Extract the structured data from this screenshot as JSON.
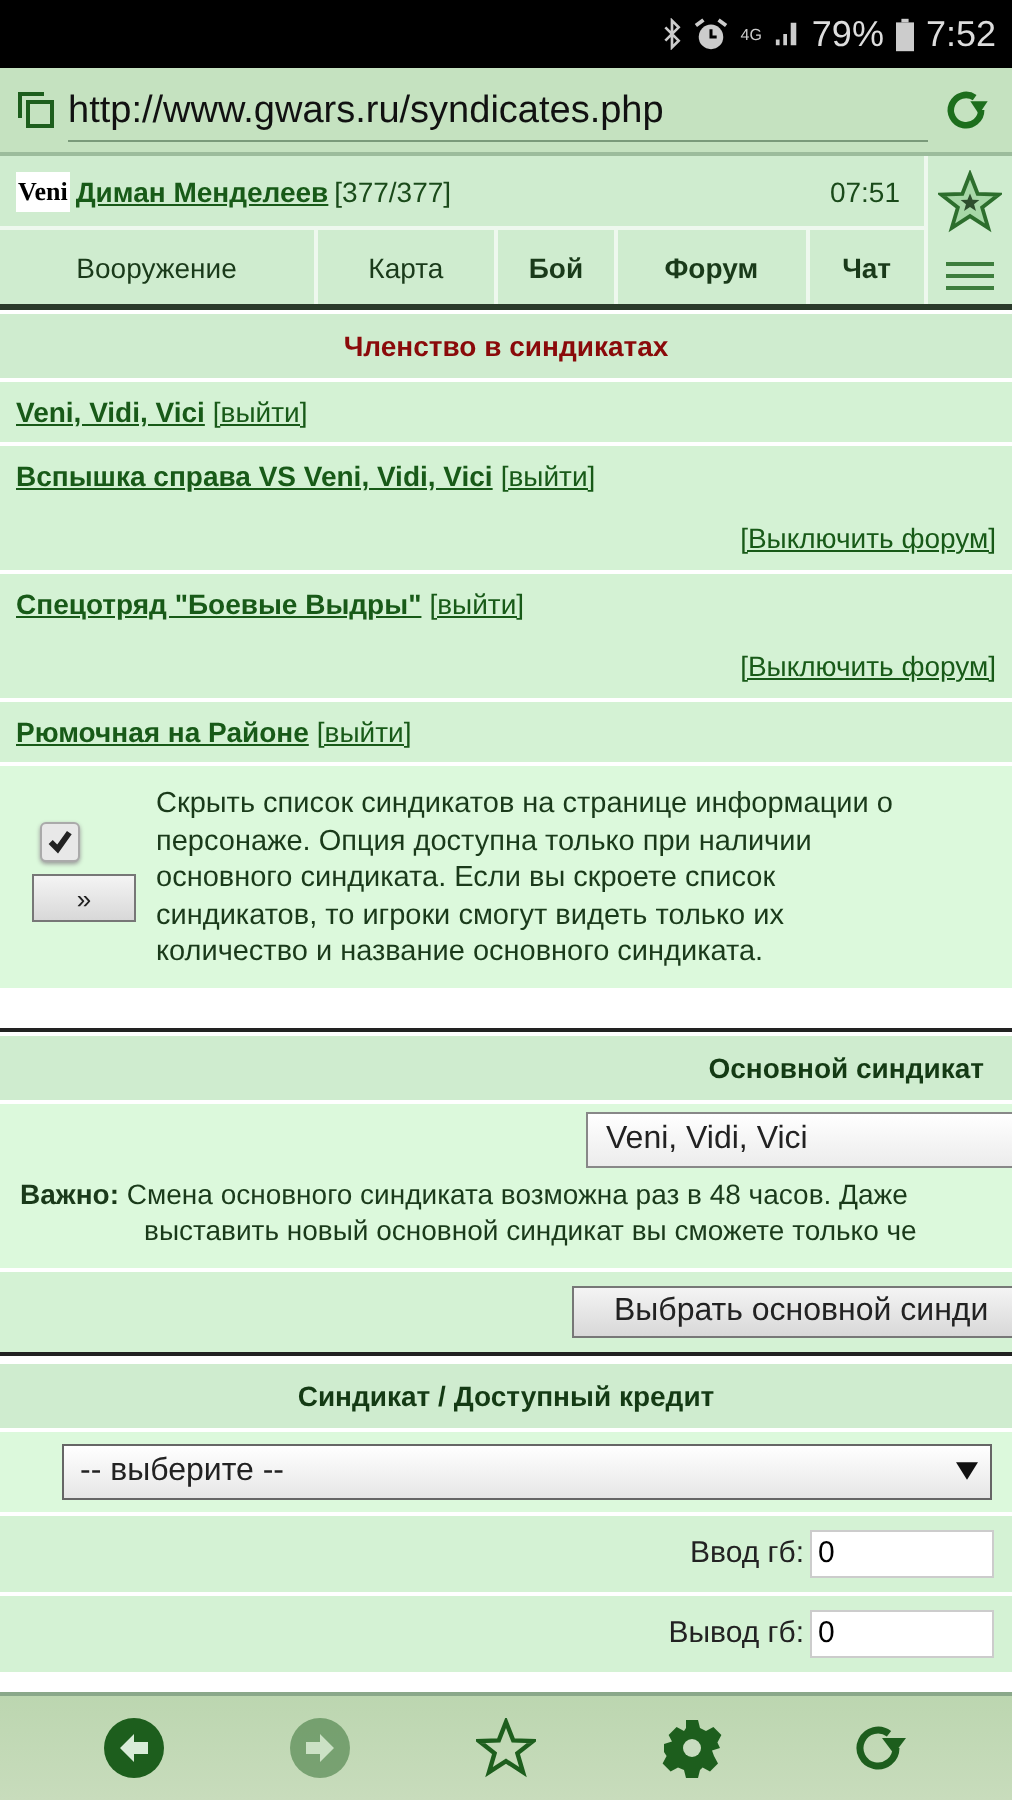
{
  "status_bar": {
    "network": "4G",
    "battery": "79%",
    "time": "7:52"
  },
  "address_bar": {
    "url": "http://www.gwars.ru/syndicates.php"
  },
  "header": {
    "badge": "Veni",
    "player": "Диман Менделеев",
    "hp": "[377/377]",
    "time": "07:51"
  },
  "nav": [
    {
      "label": "Вооружение",
      "bold": false
    },
    {
      "label": "Карта",
      "bold": false
    },
    {
      "label": "Бой",
      "bold": true
    },
    {
      "label": "Форум",
      "bold": true
    },
    {
      "label": "Чат",
      "bold": true
    }
  ],
  "membership": {
    "title": "Членство в синдикатах",
    "items": [
      {
        "name": "Veni, Vidi, Vici",
        "leave": "[выйти]"
      },
      {
        "name": "Вспышка справа VS Veni, Vidi, Vici",
        "leave": "[выйти]",
        "forum": "[Выключить форум]"
      },
      {
        "name": "Спецотряд \"Боевые Выдры\"",
        "leave": "[выйти]",
        "forum": "[Выключить форум]"
      },
      {
        "name": "Рюмочная на Районе",
        "leave": "[выйти]"
      }
    ],
    "hide_option": {
      "checked": true,
      "button": "»",
      "text": "Скрыть список синдикатов на странице информации о персонаже. Опция доступна только при наличии основного синдиката. Если вы скроете список синдикатов, то игроки смогут видеть только их количество и название основного синдиката."
    }
  },
  "main_syndicate": {
    "title": "Основной синдикат",
    "select": "Veni, Vidi, Vici",
    "note_lines": [
      "**Важно:** Смена основного синдиката возможна раз в 48 часов. Даже",
      "выставить новый основной синдикат вы сможете только че"
    ],
    "button": "Выбрать основной синди"
  },
  "credit": {
    "title": "Синдикат / Доступный кредит",
    "select": "-- выберите --",
    "fields": [
      {
        "label": "Ввод гб:",
        "value": "0"
      },
      {
        "label": "Вывод гб:",
        "value": "0"
      }
    ]
  },
  "toolbar": [
    {
      "kind": "back",
      "disabled": false
    },
    {
      "kind": "forward",
      "disabled": true
    },
    {
      "kind": "star",
      "disabled": false
    },
    {
      "kind": "settings",
      "disabled": false
    },
    {
      "kind": "reload",
      "disabled": false
    }
  ]
}
